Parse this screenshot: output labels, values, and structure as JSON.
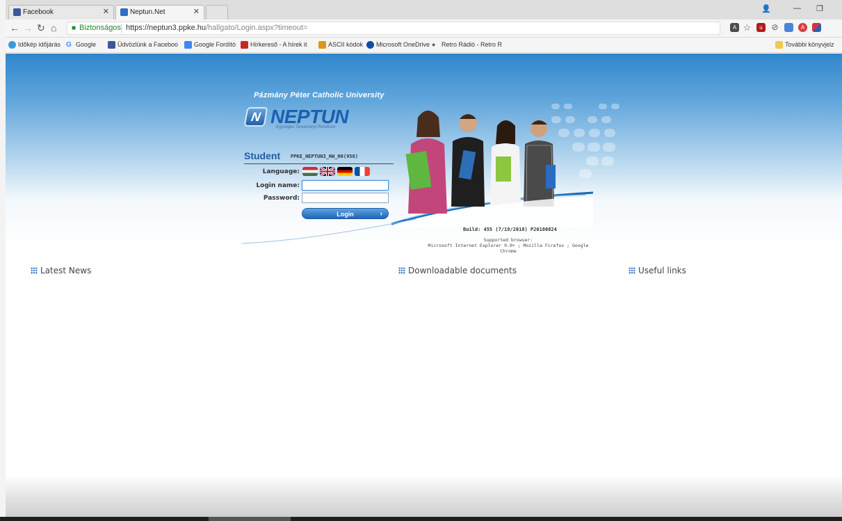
{
  "browser": {
    "tabs": [
      {
        "title": "Facebook",
        "active": false
      },
      {
        "title": "Neptun.Net PPKE_NEPTU",
        "active": true
      }
    ],
    "address": {
      "secure_label": "Biztonságos",
      "url_host": "https://neptun3.ppke.hu",
      "url_path": "/hallgato/Login.aspx?timeout="
    },
    "bookmarks": [
      {
        "label": "Időkép időjárás",
        "icon": "weather-icon"
      },
      {
        "label": "Google",
        "icon": "google-icon"
      },
      {
        "label": "Üdvözlünk a Faceboo",
        "icon": "facebook-icon"
      },
      {
        "label": "Google Fordító",
        "icon": "translate-icon"
      },
      {
        "label": "Hírkereső - A hírek it",
        "icon": "hirkereso-icon"
      },
      {
        "label": "ASCII kódok",
        "icon": "ascii-icon"
      },
      {
        "label": "Microsoft OneDrive",
        "icon": "onedrive-icon"
      },
      {
        "label": "Retro Rádió - Retro R",
        "icon": "retro-radio-icon"
      }
    ],
    "other_bookmarks": "További könyvjelz"
  },
  "login": {
    "university": "Pázmány Péter Catholic University",
    "logo_text": "NEPTUN",
    "logo_subtitle": "Egységes Tanulmányi Rendszer",
    "role": "Student",
    "server_code": "PPKE_NEPTUN3_HW_H0(958)",
    "language_label": "Language:",
    "login_name_label": "Login name:",
    "password_label": "Password:",
    "login_name_value": "",
    "password_value": "",
    "login_button": "Login",
    "build": "Build: 455 (7/19/2018) P20180824",
    "supported_title": "Supported browser:",
    "supported_list": "Microsoft Internet Explorer 9.0+ ; Mozilla Firefox ; Google Chrome"
  },
  "sections": {
    "news": "Latest News",
    "documents": "Downloadable documents",
    "links": "Useful links"
  }
}
